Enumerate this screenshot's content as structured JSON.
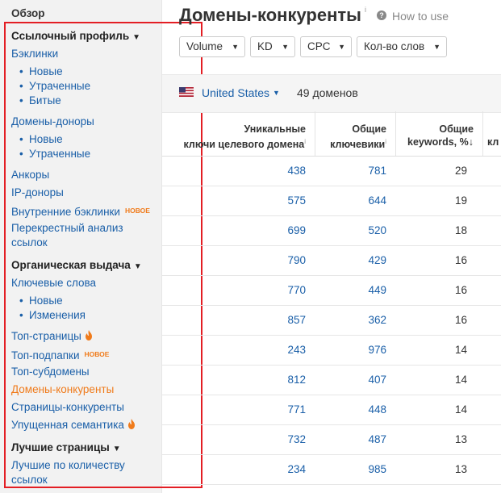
{
  "sidebar": {
    "overview": "Обзор",
    "backlink_profile": "Ссылочный профиль",
    "backlinks": "Бэклинки",
    "backlinks_new": "Новые",
    "backlinks_lost": "Утраченные",
    "backlinks_broken": "Битые",
    "ref_domains": "Домены-доноры",
    "ref_domains_new": "Новые",
    "ref_domains_lost": "Утраченные",
    "anchors": "Анкоры",
    "ref_ips": "IP-доноры",
    "internal_backlinks": "Внутренние бэклинки",
    "internal_badge": "НОВОЕ",
    "link_intersect": "Перекрестный анализ",
    "link_intersect_2": "ссылок",
    "organic_search": "Органическая выдача",
    "organic_keywords": "Ключевые слова",
    "keywords_new": "Новые",
    "keywords_changes": "Изменения",
    "top_pages": "Топ-страницы",
    "top_subfolders": "Топ-подпапки",
    "subfolders_badge": "НОВОЕ",
    "top_subdomains": "Топ-субдомены",
    "competing_domains": "Домены-конкуренты",
    "competing_pages": "Страницы-конкуренты",
    "content_gap": "Упущенная семантика",
    "best_pages": "Лучшие страницы",
    "best_by_links": "Лучшие по количеству",
    "best_by_links_2": "ссылок"
  },
  "header": {
    "title": "Домены-конкуренты",
    "info": "i",
    "howto_icon": "?",
    "howto": "How to use"
  },
  "filters": {
    "volume": "Volume",
    "kd": "KD",
    "cpc": "CPC",
    "word_count": "Кол-во слов"
  },
  "country": {
    "name": "United States",
    "domains_count": "49 доменов"
  },
  "table": {
    "col1_line1": "Уникальные",
    "col1_line2": "ключи целевого домена",
    "col2_line1": "Общие",
    "col2_line2": "ключевики",
    "col3_line1": "Общие",
    "col3_line2": "keywords, %",
    "col4_partial": "кл",
    "info": "i",
    "sort_arrow": "↓",
    "rows": [
      {
        "unique": "438",
        "common": "781",
        "pct": "29"
      },
      {
        "unique": "575",
        "common": "644",
        "pct": "19"
      },
      {
        "unique": "699",
        "common": "520",
        "pct": "18"
      },
      {
        "unique": "790",
        "common": "429",
        "pct": "16"
      },
      {
        "unique": "770",
        "common": "449",
        "pct": "16"
      },
      {
        "unique": "857",
        "common": "362",
        "pct": "16"
      },
      {
        "unique": "243",
        "common": "976",
        "pct": "14"
      },
      {
        "unique": "812",
        "common": "407",
        "pct": "14"
      },
      {
        "unique": "771",
        "common": "448",
        "pct": "14"
      },
      {
        "unique": "732",
        "common": "487",
        "pct": "13"
      },
      {
        "unique": "234",
        "common": "985",
        "pct": "13"
      }
    ]
  },
  "colors": {
    "link": "#1a5fa8",
    "accent_orange": "#f07b1b",
    "highlight_frame": "#e31e24"
  }
}
